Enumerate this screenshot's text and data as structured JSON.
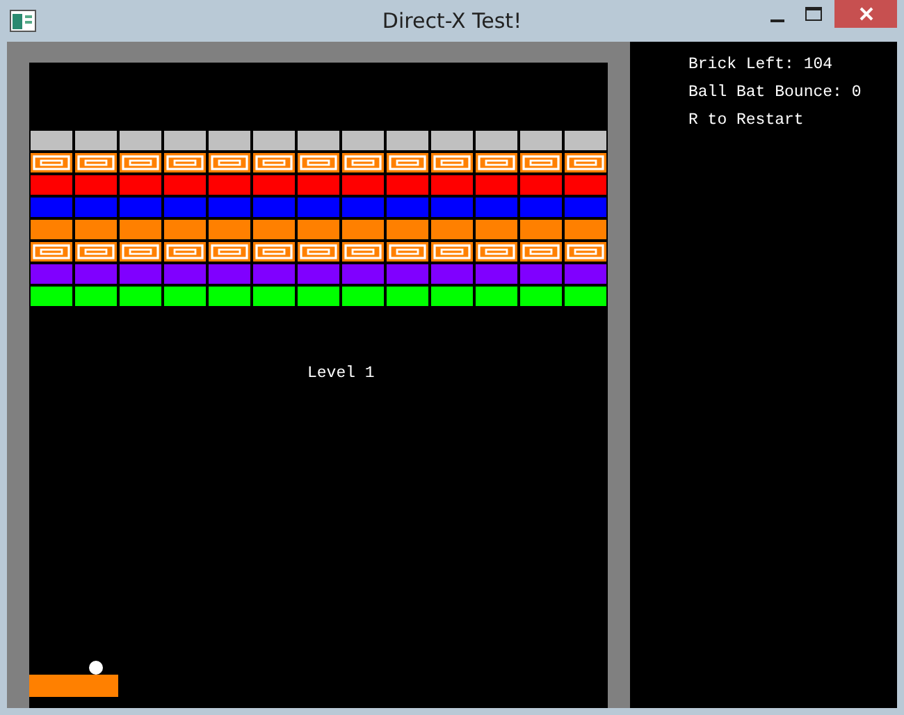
{
  "window": {
    "title": "Direct-X Test!"
  },
  "game": {
    "level_text": "Level 1",
    "brick_rows": [
      {
        "color": "#c0c0c0",
        "kind": "plain"
      },
      {
        "color": "#ff8000",
        "kind": "patterned"
      },
      {
        "color": "#ff0000",
        "kind": "plain"
      },
      {
        "color": "#0000ff",
        "kind": "plain"
      },
      {
        "color": "#ff8000",
        "kind": "plain"
      },
      {
        "color": "#ff8000",
        "kind": "patterned"
      },
      {
        "color": "#8000ff",
        "kind": "plain"
      },
      {
        "color": "#00ff00",
        "kind": "plain"
      }
    ]
  },
  "info_panel": [
    "Brick Left: 104",
    "Ball Bat Bounce: 0",
    "R to Restart"
  ]
}
